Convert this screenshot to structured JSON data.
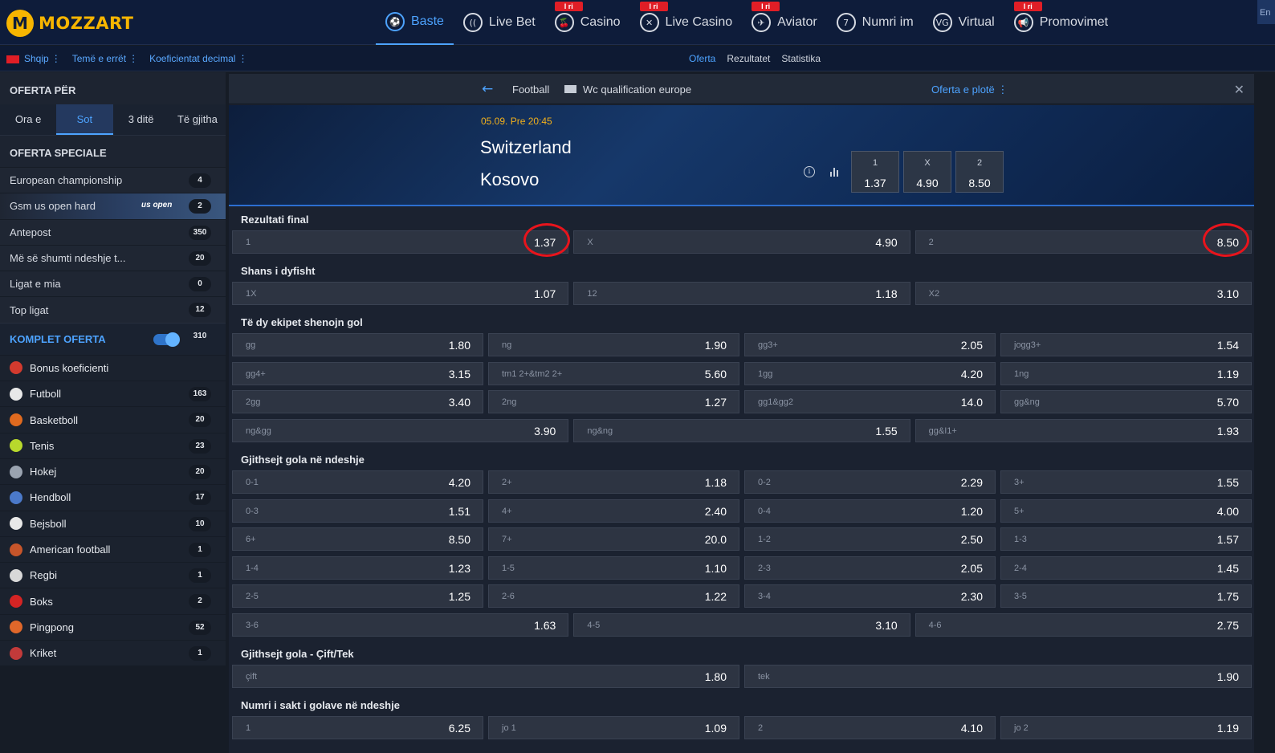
{
  "header": {
    "logo_mark": "M",
    "logo_text": "MOZZART",
    "nav": [
      {
        "label": "Baste",
        "icon": "football-icon",
        "glyph": "⚽",
        "badge": ""
      },
      {
        "label": "Live Bet",
        "icon": "live-stream-icon",
        "glyph": "((",
        "badge": ""
      },
      {
        "label": "Casino",
        "icon": "cherries-icon",
        "glyph": "🍒",
        "badge": "I ri"
      },
      {
        "label": "Live Casino",
        "icon": "chip-icon",
        "glyph": "✕",
        "badge": "I ri"
      },
      {
        "label": "Aviator",
        "icon": "airplane-icon",
        "glyph": "✈",
        "badge": "I ri"
      },
      {
        "label": "Numri im",
        "icon": "number-seven-icon",
        "glyph": "7",
        "badge": ""
      },
      {
        "label": "Virtual",
        "icon": "virtual-icon",
        "glyph": "VG",
        "badge": ""
      },
      {
        "label": "Promovimet",
        "icon": "megaphone-icon",
        "glyph": "📢",
        "badge": "I ri"
      }
    ],
    "corner_label": "En"
  },
  "subbar": {
    "language": "Shqip",
    "theme": "Temë e errët",
    "odds_format": "Koeficientat decimal",
    "tabs": [
      "Oferta",
      "Rezultatet",
      "Statistika"
    ]
  },
  "sidebar": {
    "offer_for": "OFERTA PËR",
    "time_tabs": [
      "Ora e",
      "Sot",
      "3 ditë",
      "Të gjitha"
    ],
    "special_title": "OFERTA SPECIALE",
    "special_items": [
      {
        "label": "European championship",
        "count": "4"
      },
      {
        "label": "Gsm us open hard",
        "count": "2",
        "banner": "us open"
      },
      {
        "label": "Antepost",
        "count": "350"
      },
      {
        "label": "Më së shumti ndeshje t...",
        "count": "20"
      },
      {
        "label": "Ligat e mia",
        "count": "0"
      },
      {
        "label": "Top ligat",
        "count": "12"
      }
    ],
    "komplet_label": "KOMPLET OFERTA",
    "komplet_count": "310",
    "sports": [
      {
        "label": "Bonus koeficienti",
        "count": "",
        "color": "#d23a2e"
      },
      {
        "label": "Futboll",
        "count": "163",
        "color": "#e8e8e8"
      },
      {
        "label": "Basketboll",
        "count": "20",
        "color": "#e06a1f"
      },
      {
        "label": "Tenis",
        "count": "23",
        "color": "#b8d82c"
      },
      {
        "label": "Hokej",
        "count": "20",
        "color": "#9aa3b0"
      },
      {
        "label": "Hendboll",
        "count": "17",
        "color": "#4b79c9"
      },
      {
        "label": "Bejsboll",
        "count": "10",
        "color": "#e8e8e8"
      },
      {
        "label": "American football",
        "count": "1",
        "color": "#c7552a"
      },
      {
        "label": "Regbi",
        "count": "1",
        "color": "#d8d8d8"
      },
      {
        "label": "Boks",
        "count": "2",
        "color": "#d42424"
      },
      {
        "label": "Pingpong",
        "count": "52",
        "color": "#e0672a"
      },
      {
        "label": "Kriket",
        "count": "1",
        "color": "#c23a3a"
      }
    ]
  },
  "match": {
    "sport": "Football",
    "league": "Wc qualification europe",
    "full_offer": "Oferta e plotë",
    "datetime": "05.09. Pre 20:45",
    "home": "Switzerland",
    "away": "Kosovo",
    "hero_odds": [
      {
        "label": "1",
        "value": "1.37"
      },
      {
        "label": "X",
        "value": "4.90"
      },
      {
        "label": "2",
        "value": "8.50"
      }
    ]
  },
  "markets": {
    "final": {
      "title": "Rezultati final",
      "odds": [
        {
          "label": "1",
          "value": "1.37"
        },
        {
          "label": "X",
          "value": "4.90"
        },
        {
          "label": "2",
          "value": "8.50"
        }
      ]
    },
    "double": {
      "title": "Shans i dyfisht",
      "odds": [
        {
          "label": "1X",
          "value": "1.07"
        },
        {
          "label": "12",
          "value": "1.18"
        },
        {
          "label": "X2",
          "value": "3.10"
        }
      ]
    },
    "btts": {
      "title": "Të dy ekipet shenojn gol",
      "grid": [
        {
          "label": "gg",
          "value": "1.80"
        },
        {
          "label": "ng",
          "value": "1.90"
        },
        {
          "label": "gg3+",
          "value": "2.05"
        },
        {
          "label": "jogg3+",
          "value": "1.54"
        },
        {
          "label": "gg4+",
          "value": "3.15"
        },
        {
          "label": "tm1 2+&tm2 2+",
          "value": "5.60"
        },
        {
          "label": "1gg",
          "value": "4.20"
        },
        {
          "label": "1ng",
          "value": "1.19"
        },
        {
          "label": "2gg",
          "value": "3.40"
        },
        {
          "label": "2ng",
          "value": "1.27"
        },
        {
          "label": "gg1&gg2",
          "value": "14.0"
        },
        {
          "label": "gg&ng",
          "value": "5.70"
        }
      ],
      "last": [
        {
          "label": "ng&gg",
          "value": "3.90"
        },
        {
          "label": "ng&ng",
          "value": "1.55"
        },
        {
          "label": "gg&I1+",
          "value": "1.93"
        }
      ]
    },
    "total": {
      "title": "Gjithsejt gola në ndeshje",
      "grid": [
        {
          "label": "0-1",
          "value": "4.20"
        },
        {
          "label": "2+",
          "value": "1.18"
        },
        {
          "label": "0-2",
          "value": "2.29"
        },
        {
          "label": "3+",
          "value": "1.55"
        },
        {
          "label": "0-3",
          "value": "1.51"
        },
        {
          "label": "4+",
          "value": "2.40"
        },
        {
          "label": "0-4",
          "value": "1.20"
        },
        {
          "label": "5+",
          "value": "4.00"
        },
        {
          "label": "6+",
          "value": "8.50"
        },
        {
          "label": "7+",
          "value": "20.0"
        },
        {
          "label": "1-2",
          "value": "2.50"
        },
        {
          "label": "1-3",
          "value": "1.57"
        },
        {
          "label": "1-4",
          "value": "1.23"
        },
        {
          "label": "1-5",
          "value": "1.10"
        },
        {
          "label": "2-3",
          "value": "2.05"
        },
        {
          "label": "2-4",
          "value": "1.45"
        },
        {
          "label": "2-5",
          "value": "1.25"
        },
        {
          "label": "2-6",
          "value": "1.22"
        },
        {
          "label": "3-4",
          "value": "2.30"
        },
        {
          "label": "3-5",
          "value": "1.75"
        }
      ],
      "last": [
        {
          "label": "3-6",
          "value": "1.63"
        },
        {
          "label": "4-5",
          "value": "3.10"
        },
        {
          "label": "4-6",
          "value": "2.75"
        }
      ]
    },
    "oddeven": {
      "title": "Gjithsejt gola - Çift/Tek",
      "odds": [
        {
          "label": "çift",
          "value": "1.80"
        },
        {
          "label": "tek",
          "value": "1.90"
        }
      ]
    },
    "exact": {
      "title": "Numri i sakt i golave në ndeshje",
      "odds": [
        {
          "label": "1",
          "value": "6.25"
        },
        {
          "label": "jo 1",
          "value": "1.09"
        },
        {
          "label": "2",
          "value": "4.10"
        },
        {
          "label": "jo 2",
          "value": "1.19"
        }
      ]
    }
  },
  "colors": {
    "accent": "#4da3ff",
    "badge": "#e01e26",
    "highlight_ring": "#e8141c",
    "date": "#f3b01b",
    "logo": "#f7b500"
  }
}
